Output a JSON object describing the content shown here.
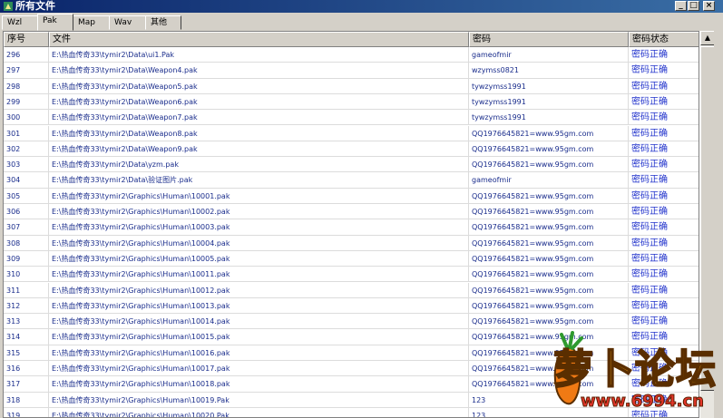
{
  "window": {
    "title": "所有文件",
    "buttons": [
      "_",
      "□",
      "×"
    ]
  },
  "tabs": [
    "Wzl",
    "Pak",
    "Map",
    "Wav",
    "其他"
  ],
  "active_tab": 1,
  "table": {
    "columns": [
      "序号",
      "文件",
      "密码",
      "密码状态"
    ],
    "rows": [
      [
        "296",
        "E:\\热血传奇33\\tymir2\\Data\\ui1.Pak",
        "gameofmir",
        "密码正确"
      ],
      [
        "297",
        "E:\\热血传奇33\\tymir2\\Data\\Weapon4.pak",
        "wzymss0821",
        "密码正确"
      ],
      [
        "298",
        "E:\\热血传奇33\\tymir2\\Data\\Weapon5.pak",
        "tywzymss1991",
        "密码正确"
      ],
      [
        "299",
        "E:\\热血传奇33\\tymir2\\Data\\Weapon6.pak",
        "tywzymss1991",
        "密码正确"
      ],
      [
        "300",
        "E:\\热血传奇33\\tymir2\\Data\\Weapon7.pak",
        "tywzymss1991",
        "密码正确"
      ],
      [
        "301",
        "E:\\热血传奇33\\tymir2\\Data\\Weapon8.pak",
        "QQ1976645821=www.95gm.com",
        "密码正确"
      ],
      [
        "302",
        "E:\\热血传奇33\\tymir2\\Data\\Weapon9.pak",
        "QQ1976645821=www.95gm.com",
        "密码正确"
      ],
      [
        "303",
        "E:\\热血传奇33\\tymir2\\Data\\yzm.pak",
        "QQ1976645821=www.95gm.com",
        "密码正确"
      ],
      [
        "304",
        "E:\\热血传奇33\\tymir2\\Data\\验证图片.pak",
        "gameofmir",
        "密码正确"
      ],
      [
        "305",
        "E:\\热血传奇33\\tymir2\\Graphics\\Human\\10001.pak",
        "QQ1976645821=www.95gm.com",
        "密码正确"
      ],
      [
        "306",
        "E:\\热血传奇33\\tymir2\\Graphics\\Human\\10002.pak",
        "QQ1976645821=www.95gm.com",
        "密码正确"
      ],
      [
        "307",
        "E:\\热血传奇33\\tymir2\\Graphics\\Human\\10003.pak",
        "QQ1976645821=www.95gm.com",
        "密码正确"
      ],
      [
        "308",
        "E:\\热血传奇33\\tymir2\\Graphics\\Human\\10004.pak",
        "QQ1976645821=www.95gm.com",
        "密码正确"
      ],
      [
        "309",
        "E:\\热血传奇33\\tymir2\\Graphics\\Human\\10005.pak",
        "QQ1976645821=www.95gm.com",
        "密码正确"
      ],
      [
        "310",
        "E:\\热血传奇33\\tymir2\\Graphics\\Human\\10011.pak",
        "QQ1976645821=www.95gm.com",
        "密码正确"
      ],
      [
        "311",
        "E:\\热血传奇33\\tymir2\\Graphics\\Human\\10012.pak",
        "QQ1976645821=www.95gm.com",
        "密码正确"
      ],
      [
        "312",
        "E:\\热血传奇33\\tymir2\\Graphics\\Human\\10013.pak",
        "QQ1976645821=www.95gm.com",
        "密码正确"
      ],
      [
        "313",
        "E:\\热血传奇33\\tymir2\\Graphics\\Human\\10014.pak",
        "QQ1976645821=www.95gm.com",
        "密码正确"
      ],
      [
        "314",
        "E:\\热血传奇33\\tymir2\\Graphics\\Human\\10015.pak",
        "QQ1976645821=www.95gm.com",
        "密码正确"
      ],
      [
        "315",
        "E:\\热血传奇33\\tymir2\\Graphics\\Human\\10016.pak",
        "QQ1976645821=www.95gm.com",
        "密码正确"
      ],
      [
        "316",
        "E:\\热血传奇33\\tymir2\\Graphics\\Human\\10017.pak",
        "QQ1976645821=www.95gm.com",
        "密码正确"
      ],
      [
        "317",
        "E:\\热血传奇33\\tymir2\\Graphics\\Human\\10018.pak",
        "QQ1976645821=www.95gm.com",
        "密码正确"
      ],
      [
        "318",
        "E:\\热血传奇33\\tymir2\\Graphics\\Human\\10019.Pak",
        "123",
        "密码正确"
      ],
      [
        "319",
        "E:\\热血传奇33\\tymir2\\Graphics\\Human\\10020.Pak",
        "123",
        "密码正确"
      ]
    ]
  },
  "scrollbar": {
    "up": "▲",
    "down": "▼"
  },
  "watermark": {
    "text": "萝卜论坛",
    "url": "www.6994.cn"
  },
  "colors": {
    "title_start": "#0a246a",
    "title_end": "#3a6ea5",
    "cell_text": "#1a2d8c"
  }
}
